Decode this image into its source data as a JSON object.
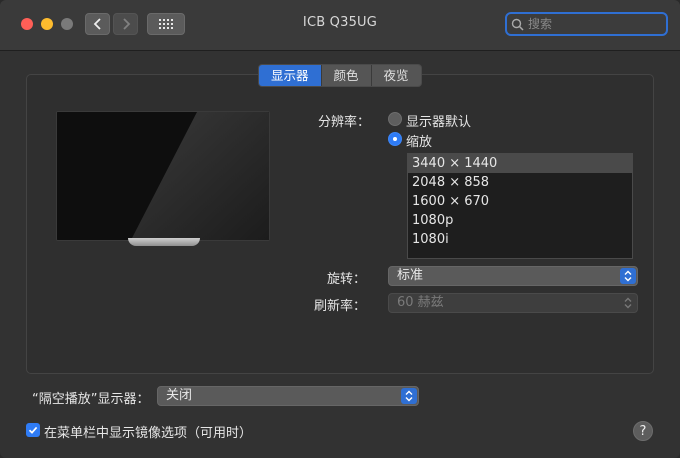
{
  "window": {
    "title": "ICB Q35UG"
  },
  "search": {
    "placeholder": "搜索"
  },
  "tabs": [
    {
      "label": "显示器",
      "active": true
    },
    {
      "label": "颜色",
      "active": false
    },
    {
      "label": "夜览",
      "active": false
    }
  ],
  "resolution": {
    "label": "分辨率：",
    "options": [
      {
        "label": "显示器默认",
        "selected": false
      },
      {
        "label": "缩放",
        "selected": true
      }
    ],
    "list": [
      "3440 × 1440",
      "2048 × 858",
      "1600 × 670",
      "1080p",
      "1080i"
    ],
    "selected_index": 0
  },
  "rotation": {
    "label": "旋转：",
    "value": "标准"
  },
  "refresh": {
    "label": "刷新率：",
    "value": "60 赫兹",
    "disabled": true
  },
  "airplay": {
    "label": "“隔空播放”显示器：",
    "value": "关闭"
  },
  "mirror_option": {
    "label": "在菜单栏中显示镜像选项（可用时）",
    "checked": true
  },
  "help": {
    "label": "?"
  },
  "colors": {
    "accent": "#2f6fd3",
    "window_bg": "#323232"
  }
}
